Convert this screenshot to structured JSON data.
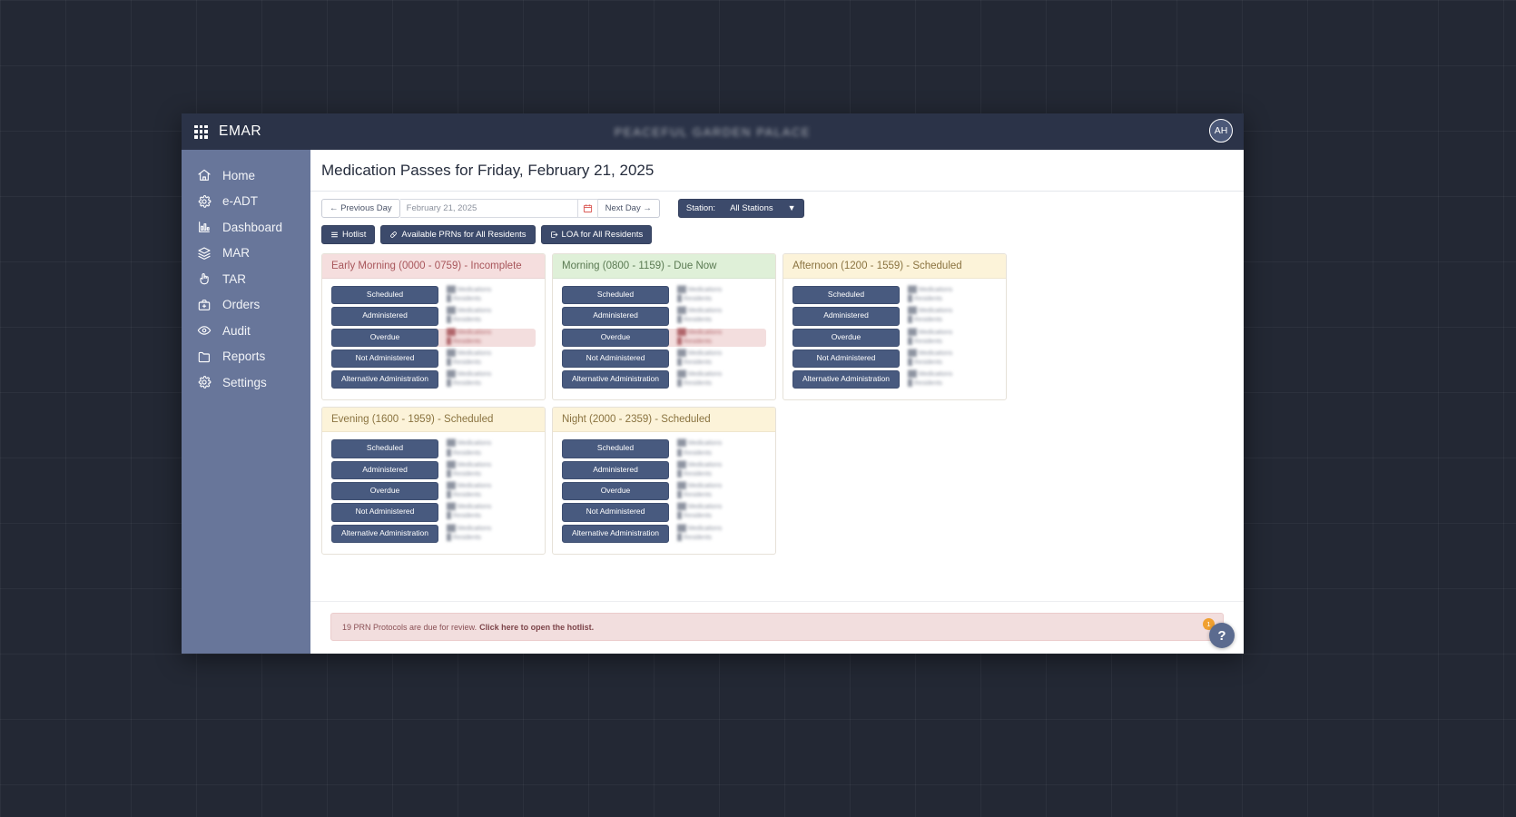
{
  "header": {
    "brand": "EMAR",
    "facility": "PEACEFUL GARDEN PALACE",
    "avatar_initials": "AH",
    "grid_icon": "apps-grid-icon",
    "bg_color": "#2b3348"
  },
  "sidebar": {
    "bg_color": "#68769a",
    "items": [
      {
        "label": "Home",
        "icon": "home-icon"
      },
      {
        "label": "e-ADT",
        "icon": "gear-icon"
      },
      {
        "label": "Dashboard",
        "icon": "bar-chart-icon"
      },
      {
        "label": "MAR",
        "icon": "layers-icon"
      },
      {
        "label": "TAR",
        "icon": "hand-pointer-icon"
      },
      {
        "label": "Orders",
        "icon": "briefcase-plus-icon"
      },
      {
        "label": "Audit",
        "icon": "eye-icon"
      },
      {
        "label": "Reports",
        "icon": "folder-icon"
      },
      {
        "label": "Settings",
        "icon": "gear-icon"
      }
    ]
  },
  "main": {
    "page_title": "Medication Passes for Friday, February 21, 2025",
    "toolbar": {
      "previous_day": "Previous Day",
      "next_day": "Next Day",
      "date_value": "February 21, 2025",
      "date_placeholder": "February 21, 2025",
      "calendar_icon": "calendar-icon",
      "station_label": "Station:",
      "station_value": "All Stations",
      "station_options": [
        "All Stations"
      ],
      "hotlist": "Hotlist",
      "available_prns": "Available PRNs for All Residents",
      "loa": "LOA for All Residents"
    },
    "stat_labels": [
      "Scheduled",
      "Administered",
      "Overdue",
      "Not Administered",
      "Alternative Administration"
    ],
    "cards": [
      {
        "title": "Early Morning (0000 - 0759) - Incomplete",
        "state": "incomplete",
        "header_color": "#f5dede",
        "rows": [
          {
            "label": "Scheduled",
            "medications": "",
            "residents": "",
            "alert": false
          },
          {
            "label": "Administered",
            "medications": "",
            "residents": "",
            "alert": false
          },
          {
            "label": "Overdue",
            "medications": "",
            "residents": "",
            "alert": true
          },
          {
            "label": "Not Administered",
            "medications": "",
            "residents": "",
            "alert": false
          },
          {
            "label": "Alternative Administration",
            "medications": "",
            "residents": "",
            "alert": false
          }
        ]
      },
      {
        "title": "Morning (0800 - 1159) - Due Now",
        "state": "duenow",
        "header_color": "#dff0d8",
        "rows": [
          {
            "label": "Scheduled",
            "medications": "",
            "residents": "",
            "alert": false
          },
          {
            "label": "Administered",
            "medications": "",
            "residents": "",
            "alert": false
          },
          {
            "label": "Overdue",
            "medications": "",
            "residents": "",
            "alert": true
          },
          {
            "label": "Not Administered",
            "medications": "",
            "residents": "",
            "alert": false
          },
          {
            "label": "Alternative Administration",
            "medications": "",
            "residents": "",
            "alert": false
          }
        ]
      },
      {
        "title": "Afternoon (1200 - 1559) - Scheduled",
        "state": "scheduled",
        "header_color": "#fcf3d9",
        "rows": [
          {
            "label": "Scheduled",
            "medications": "",
            "residents": "",
            "alert": false
          },
          {
            "label": "Administered",
            "medications": "",
            "residents": "",
            "alert": false
          },
          {
            "label": "Overdue",
            "medications": "",
            "residents": "",
            "alert": false
          },
          {
            "label": "Not Administered",
            "medications": "",
            "residents": "",
            "alert": false
          },
          {
            "label": "Alternative Administration",
            "medications": "",
            "residents": "",
            "alert": false
          }
        ]
      },
      {
        "title": "Evening (1600 - 1959) - Scheduled",
        "state": "scheduled",
        "header_color": "#fcf3d9",
        "rows": [
          {
            "label": "Scheduled",
            "medications": "",
            "residents": "",
            "alert": false
          },
          {
            "label": "Administered",
            "medications": "",
            "residents": "",
            "alert": false
          },
          {
            "label": "Overdue",
            "medications": "",
            "residents": "",
            "alert": false
          },
          {
            "label": "Not Administered",
            "medications": "",
            "residents": "",
            "alert": false
          },
          {
            "label": "Alternative Administration",
            "medications": "",
            "residents": "",
            "alert": false
          }
        ]
      },
      {
        "title": "Night (2000 - 2359) - Scheduled",
        "state": "scheduled",
        "header_color": "#fcf3d9",
        "rows": [
          {
            "label": "Scheduled",
            "medications": "",
            "residents": "",
            "alert": false
          },
          {
            "label": "Administered",
            "medications": "",
            "residents": "",
            "alert": false
          },
          {
            "label": "Overdue",
            "medications": "",
            "residents": "",
            "alert": false
          },
          {
            "label": "Not Administered",
            "medications": "",
            "residents": "",
            "alert": false
          },
          {
            "label": "Alternative Administration",
            "medications": "",
            "residents": "",
            "alert": false
          }
        ]
      }
    ]
  },
  "alert": {
    "text": "19 PRN Protocols are due for review.",
    "link_text": "Click here to open the hotlist.",
    "close_icon": "close-icon",
    "bg_color": "#f2dede"
  },
  "help": {
    "label": "?",
    "badge_count": "1",
    "badge_color": "#f0a030"
  }
}
